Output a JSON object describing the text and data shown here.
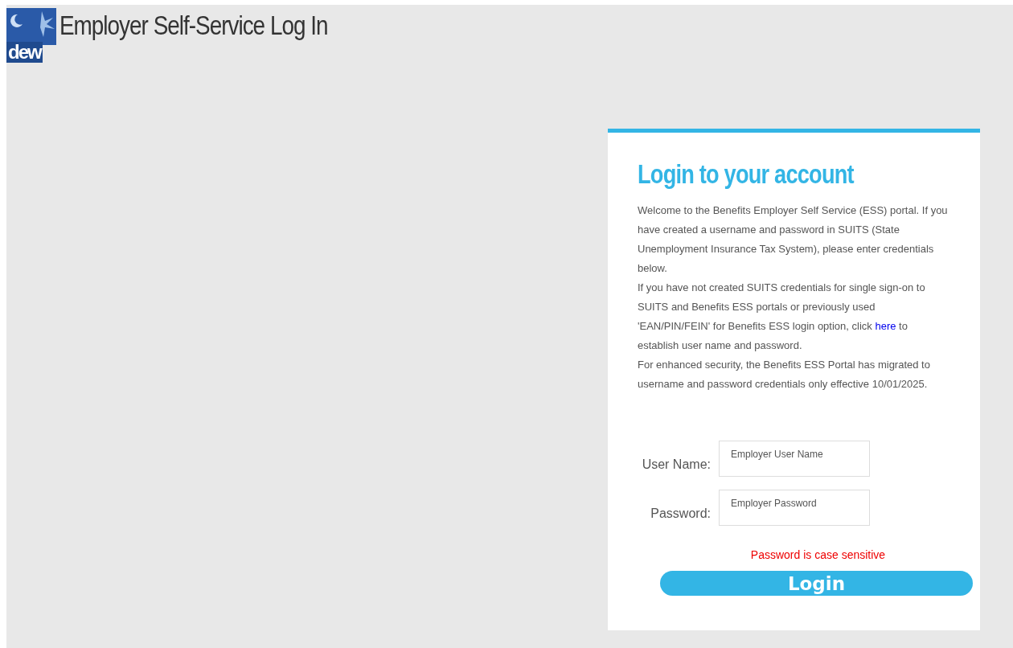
{
  "header": {
    "logo_text": "dew",
    "title": "Employer Self-Service Log In"
  },
  "login": {
    "heading": "Login to your account",
    "paragraphs": [
      {
        "text": "Welcome to the Benefits Employer Self Service (ESS) portal. If you have created a username and password in SUITS (State Unemployment Insurance Tax System), please enter credentials below."
      },
      {
        "text": "If you have not created SUITS credentials for single sign-on to SUITS and Benefits ESS portals or previously used 'EAN/PIN/FEIN' for Benefits ESS login option, click ",
        "link": "here",
        "after": " to establish user name and password."
      },
      {
        "text": "For enhanced security, the Benefits ESS Portal has migrated to username and password credentials only effective 10/01/2025."
      }
    ],
    "fields": [
      {
        "label": "User Name:",
        "placeholder": "Employer User Name"
      },
      {
        "label": "Password:",
        "placeholder": "Employer Password"
      }
    ],
    "note": "Password is case sensitive",
    "button": "Login"
  }
}
